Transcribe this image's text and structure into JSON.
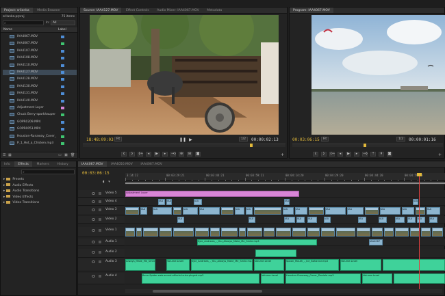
{
  "project": {
    "tabs": [
      "Project: srilanka",
      "Media Browser"
    ],
    "file": "srilanka.prproj",
    "count": "75 items",
    "search_placeholder": "",
    "in_label": "In:",
    "in_value": "All",
    "col_name": "Name",
    "col_label": "Label",
    "items": [
      {
        "name": "IAA4067.MOV",
        "color": "#4e8dd6"
      },
      {
        "name": "IAA4067.MOV",
        "color": "#3fc470"
      },
      {
        "name": "IAA4107.MOV",
        "color": "#4e8dd6"
      },
      {
        "name": "IAA4108.MOV",
        "color": "#4e8dd6"
      },
      {
        "name": "IAA4110.MOV",
        "color": "#4e8dd6"
      },
      {
        "name": "IAA4127.MOV",
        "color": "#4e8dd6"
      },
      {
        "name": "IAA4128.MOV",
        "color": "#4e8dd6"
      },
      {
        "name": "IAA4130.MOV",
        "color": "#4e8dd6"
      },
      {
        "name": "IAA4131.MOV",
        "color": "#4e8dd6"
      },
      {
        "name": "IAA4140.MOV",
        "color": "#4e8dd6"
      },
      {
        "name": "Adjustment Layer",
        "color": "#d885d6"
      },
      {
        "name": "Chuck Berry-sparkhauper",
        "color": "#3fc470"
      },
      {
        "name": "GOPR0209.MP4",
        "color": "#4e8dd6"
      },
      {
        "name": "GOPR0051.MP4",
        "color": "#4e8dd6"
      },
      {
        "name": "Houston-Runaway_Cover_",
        "color": "#3fc470"
      },
      {
        "name": "P_1_Hot_a_Chicken.mp3",
        "color": "#3fc470"
      }
    ]
  },
  "source_monitor": {
    "tabs": [
      "Source: IAA4127.MOV",
      "Effect Controls",
      "Audio Mixer: IAA4067.MOV",
      "Metadata"
    ],
    "timecode_left": "18:48:09:03",
    "timecode_right": "00:00:02:13",
    "fit": "Fit",
    "quality": "1/2"
  },
  "program_monitor": {
    "tabs": [
      "Program: IAA4067.MOV"
    ],
    "timecode_left": "00:03:06:15",
    "timecode_right": "00:00:01:16",
    "fit": "Fit",
    "quality": "1/2"
  },
  "effects": {
    "tabs": [
      "Info",
      "Effects",
      "Markers",
      "History"
    ],
    "items": [
      "Presets",
      "Audio Effects",
      "Audio Transitions",
      "Video Effects",
      "Video Transitions"
    ]
  },
  "timeline": {
    "tabs": [
      "IAA4067.MOV",
      "IAA4050.MOV",
      "IAA4067.MOV"
    ],
    "timecode": "00:03:06:15",
    "ruler": [
      "3:14:22",
      "00:03:29:21",
      "00:03:44:21",
      "00:03:59:21",
      "00:04:14:20",
      "00:04:29:20",
      "00:04:44:20",
      "00:04:59:20"
    ],
    "tracks": [
      {
        "name": "Video 5"
      },
      {
        "name": "Video 4"
      },
      {
        "name": "Video 3"
      },
      {
        "name": "Video 2"
      },
      {
        "name": "Video 1"
      },
      {
        "name": "Audio 1"
      },
      {
        "name": "Audio 2"
      },
      {
        "name": "Audio 3"
      },
      {
        "name": "Audio 4"
      }
    ],
    "adjustment_layer": "Adjustment Layer",
    "clip_label": "IAA",
    "audio_clips": [
      "Kyle_Andrews_-_You_Always_Make_Me_Smile.mp3",
      "IAA4067",
      "Always_Make_Me_Smile.mp3",
      "Volume:Level",
      "Kyle_Andrews_-_You_Always_Make_Me_Smile.mp3",
      "Volume:Level",
      "Spoon_Mouth_-_Ice_Bahavior.mp3",
      "Volume:Level",
      "Beco-Spider-web-sound-effects-to-be-played.mp3",
      "Volume:Level",
      "Houston-Runaway_Cover_Daniela.mp3",
      "Volume:Level"
    ]
  },
  "colors": {
    "video_clip": "#8db5cf",
    "audio_clip": "#3fd29a",
    "adjustment": "#d885d6",
    "timecode": "#e2b93b",
    "playhead": "#e04040"
  }
}
